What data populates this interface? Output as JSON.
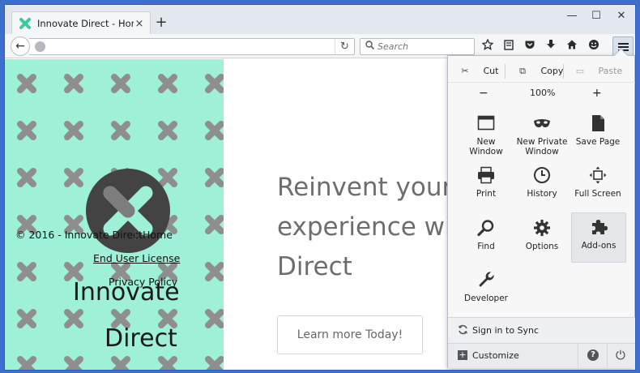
{
  "tab": {
    "title": "Innovate Direct - Home P...",
    "close": "×"
  },
  "newtab": "+",
  "window_controls": {
    "minimize": "—",
    "maximize": "☐",
    "close": "✕"
  },
  "nav": {
    "back": "←",
    "reload": "↻",
    "search_placeholder": "Search"
  },
  "page": {
    "copyright": "© 2016 - Innovate Direct",
    "separator": "|",
    "home": "Home",
    "eula": "End User License",
    "privacy": "Privacy Policy",
    "brand_line1": "Innovate",
    "brand_line2": "Direct",
    "hero_line1": "Reinvent your b",
    "hero_line2": "experience with",
    "hero_line3": "Direct",
    "cta": "Learn more Today!"
  },
  "menu": {
    "cut": "Cut",
    "copy": "Copy",
    "paste": "Paste",
    "zoom_out": "−",
    "zoom_level": "100%",
    "zoom_in": "+",
    "items": [
      {
        "label": "New Window",
        "icon": "window-icon"
      },
      {
        "label": "New Private Window",
        "icon": "mask-icon"
      },
      {
        "label": "Save Page",
        "icon": "page-icon"
      },
      {
        "label": "Print",
        "icon": "printer-icon"
      },
      {
        "label": "History",
        "icon": "clock-icon"
      },
      {
        "label": "Full Screen",
        "icon": "fullscreen-icon"
      },
      {
        "label": "Find",
        "icon": "magnifier-icon"
      },
      {
        "label": "Options",
        "icon": "gear-icon"
      },
      {
        "label": "Add-ons",
        "icon": "puzzle-icon"
      },
      {
        "label": "Developer",
        "icon": "wrench-icon"
      }
    ],
    "sign_in": "Sign in to Sync",
    "customize": "Customize",
    "help": "?",
    "quit": "⏻"
  },
  "colors": {
    "pattern_mint": "#9ef0d6",
    "pattern_x": "#8e8e8e",
    "logo_circle": "#434343",
    "titlebar_blue": "#3d6fd1"
  }
}
